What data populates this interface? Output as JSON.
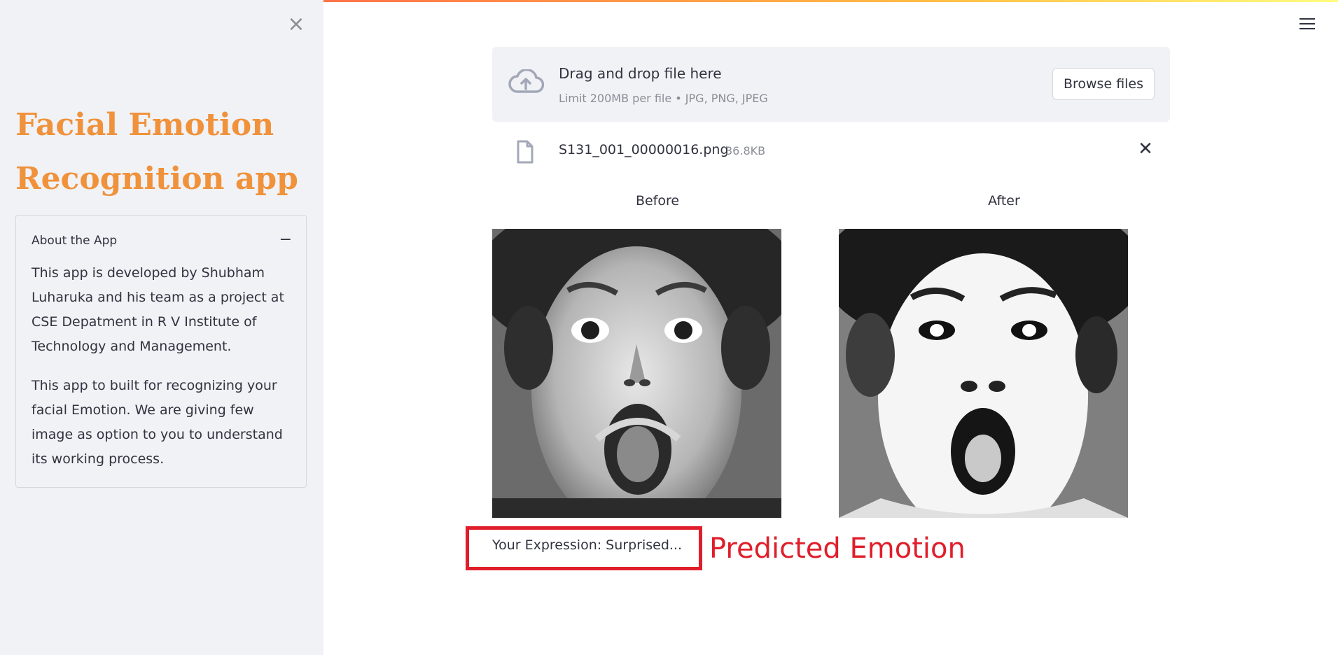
{
  "sidebar": {
    "close_icon": "close-icon",
    "title_line1": "Facial Emotion",
    "title_line2": "Recognition app",
    "expander": {
      "title": "About the App",
      "collapse_symbol": "−",
      "paragraph1": "This app is developed by Shubham Luharuka and his team as a project at CSE Depatment in R V Institute of Technology and Management.",
      "paragraph2": "This app to built for recognizing your facial Emotion. We are giving few image as option to you to understand its working process."
    }
  },
  "header": {
    "menu_icon": "hamburger-menu-icon"
  },
  "uploader": {
    "icon": "cloud-upload-icon",
    "drag_text": "Drag and drop file here",
    "limit_text": "Limit 200MB per file • JPG, PNG, JPEG",
    "browse_label": "Browse files"
  },
  "uploaded_file": {
    "icon": "file-icon",
    "name": "S131_001_00000016.png",
    "size": "36.8KB",
    "remove_symbol": "✕"
  },
  "images": {
    "before_caption": "Before",
    "after_caption": "After"
  },
  "result": {
    "text": "Your Expression: Surprised...",
    "annotation": "Predicted Emotion"
  },
  "colors": {
    "title": "#f0923b",
    "annotation": "#e01e2b",
    "sidebar_bg": "#f0f2f6"
  }
}
